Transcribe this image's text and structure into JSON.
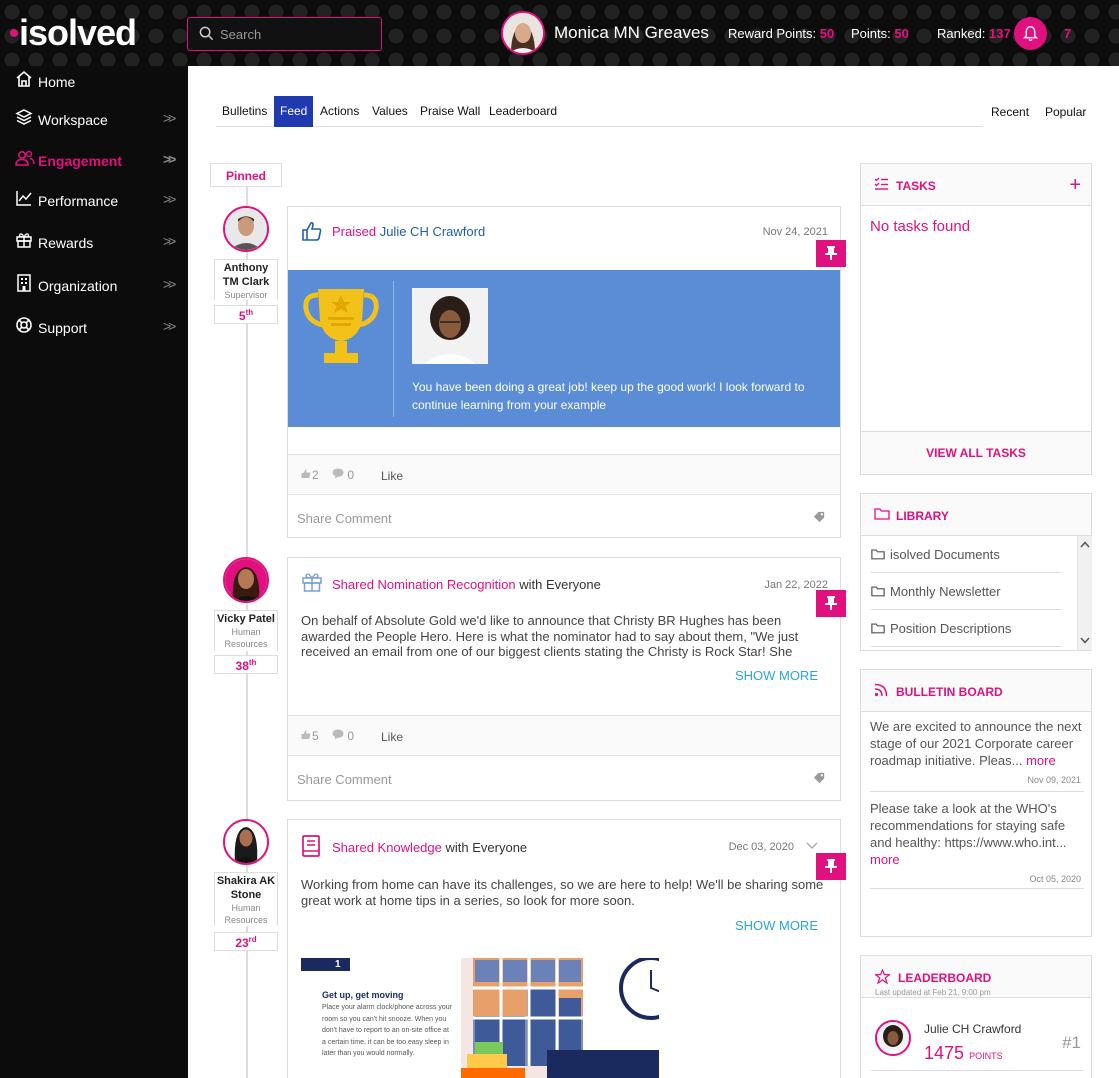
{
  "brand": {
    "logo": "isolved",
    "accent": "#e0117f",
    "dark": "#0c0c0c",
    "tab_active": "#1f39b0",
    "card_blue": "#5b8dd6"
  },
  "search": {
    "placeholder": "Search"
  },
  "user": {
    "name": "Monica MN Greaves"
  },
  "stats": {
    "reward_label": "Reward Points:",
    "reward_value": "50",
    "points_label": "Points:",
    "points_value": "50",
    "ranked_label": "Ranked:",
    "ranked_value": "137",
    "notifications": "7"
  },
  "nav": [
    {
      "label": "Home",
      "icon": "home-icon"
    },
    {
      "label": "Workspace",
      "icon": "layers-icon"
    },
    {
      "label": "Engagement",
      "icon": "people-icon"
    },
    {
      "label": "Performance",
      "icon": "chart-icon"
    },
    {
      "label": "Rewards",
      "icon": "gift-icon"
    },
    {
      "label": "Organization",
      "icon": "building-icon"
    },
    {
      "label": "Support",
      "icon": "lifebuoy-icon"
    }
  ],
  "tabs": [
    "Bulletins",
    "Feed",
    "Actions",
    "Values",
    "Praise Wall",
    "Leaderboard"
  ],
  "sort": {
    "recent": "Recent",
    "popular": "Popular"
  },
  "pinned_label": "Pinned",
  "posts": [
    {
      "author": "Anthony TM Clark",
      "role": "Supervisor",
      "rank": "5",
      "rank_suffix": "th",
      "action": "Praised",
      "target": "Julie CH Crawford",
      "date": "Nov 24, 2021",
      "message": "You have been doing a great job! keep up the good work! I look forward to continue learning from your example",
      "likes": "2",
      "comments": "0",
      "like_label": "Like",
      "share_placeholder": "Share Comment"
    },
    {
      "author": "Vicky Patel",
      "role": "Human Resources",
      "rank": "38",
      "rank_suffix": "th",
      "action": "Shared Nomination Recognition",
      "with": "with",
      "audience": "Everyone",
      "date": "Jan 22, 2022",
      "body": "On behalf of Absolute Gold we'd like to announce that Christy BR Hughes has been awarded the People Hero. Here is what the nominator had to say about them, \"We just received an email from one of our biggest clients stating the Christy is Rock Star! She allows goes above",
      "show_more": "SHOW MORE",
      "likes": "5",
      "comments": "0",
      "like_label": "Like",
      "share_placeholder": "Share Comment"
    },
    {
      "author": "Shakira AK Stone",
      "role": "Human Resources",
      "rank": "23",
      "rank_suffix": "rd",
      "action": "Shared Knowledge",
      "with": "with",
      "audience": "Everyone",
      "date": "Dec 03, 2020",
      "body": "Working from home can have its challenges, so we are here to help! We'll be sharing some great work at home tips in a series, so look for more soon.",
      "show_more": "SHOW MORE",
      "tip_number": "1",
      "tip_title": "Get up, get moving",
      "tip_text": "Place your alarm clock/phone across your room so you can't hit snooze. When you don't have to report to an on-site office at a certain time, it can be too easy sleep in later than you would normally."
    }
  ],
  "tasks": {
    "title": "TASKS",
    "empty": "No tasks found",
    "view_all": "VIEW ALL TASKS"
  },
  "library": {
    "title": "LIBRARY",
    "items": [
      "isolved Documents",
      "Monthly Newsletter",
      "Position Descriptions"
    ]
  },
  "bulletin": {
    "title": "BULLETIN BOARD",
    "items": [
      {
        "text": "We are excited to announce the next stage of our 2021 Corporate career roadmap initiative.  Pleas...",
        "more": "more",
        "date": "Nov 09, 2021"
      },
      {
        "text": "Please take a look at the WHO's recommendations for staying safe and healthy: https://www.who.int...",
        "more": "more",
        "date": "Oct 05, 2020"
      }
    ]
  },
  "leaderboard": {
    "title": "LEADERBOARD",
    "updated": "Last updated at Feb 21, 9:00 pm",
    "name": "Julie CH Crawford",
    "points": "1475",
    "points_label": "POINTS",
    "rank": "#1"
  }
}
